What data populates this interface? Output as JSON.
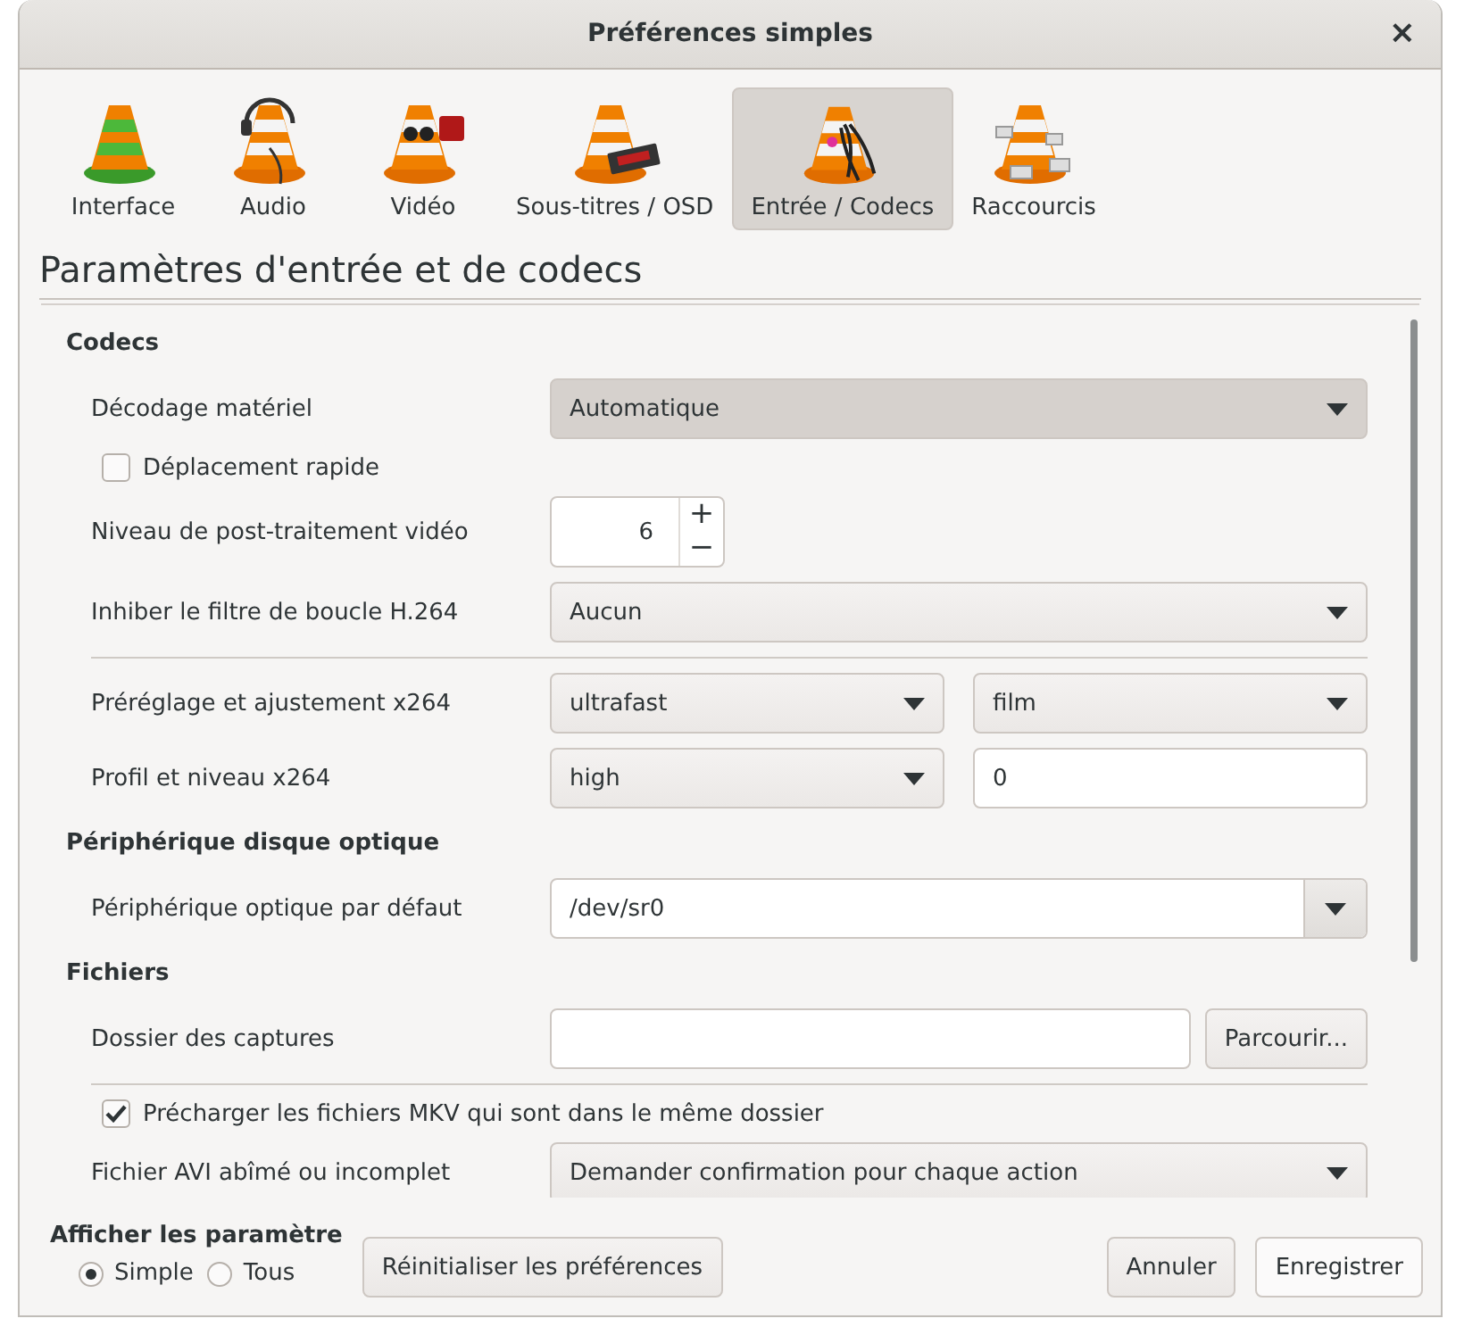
{
  "window": {
    "title": "Préférences simples",
    "close": "×"
  },
  "tabs": [
    {
      "label": "Interface",
      "kind": "interface",
      "selected": false
    },
    {
      "label": "Audio",
      "kind": "audio",
      "selected": false
    },
    {
      "label": "Vidéo",
      "kind": "video",
      "selected": false
    },
    {
      "label": "Sous-titres / OSD",
      "kind": "osd",
      "selected": false
    },
    {
      "label": "Entrée / Codecs",
      "kind": "codecs",
      "selected": true
    },
    {
      "label": "Raccourcis",
      "kind": "shortcuts",
      "selected": false
    }
  ],
  "heading": "Paramètres d'entrée et de codecs",
  "sections": [
    {
      "title": "Codecs",
      "rows": [
        {
          "kind": "select",
          "label": "Décodage matériel",
          "value": "Automatique",
          "hovered": true
        },
        {
          "kind": "checkbox",
          "label": "Déplacement rapide",
          "checked": false
        },
        {
          "kind": "spin",
          "label": "Niveau de post-traitement vidéo",
          "value": "6",
          "plus": "+",
          "minus": "−"
        },
        {
          "kind": "select",
          "label": "Inhiber le filtre de boucle H.264",
          "value": "Aucun",
          "hovered": false
        },
        {
          "kind": "separator"
        },
        {
          "kind": "select_pair",
          "label": "Préréglage et ajustement x264",
          "values": [
            "ultrafast",
            "film"
          ]
        },
        {
          "kind": "select_text",
          "label": "Profil et niveau x264",
          "value": "high",
          "text": "0"
        }
      ]
    },
    {
      "title": "Périphérique disque optique",
      "rows": [
        {
          "kind": "combo",
          "label": "Périphérique optique par défaut",
          "value": "/dev/sr0"
        }
      ]
    },
    {
      "title": "Fichiers",
      "rows": [
        {
          "kind": "folder",
          "label": "Dossier des captures",
          "button": "Parcourir..."
        },
        {
          "kind": "separator"
        },
        {
          "kind": "checkbox",
          "label": "Précharger les fichiers MKV qui sont dans le même dossier",
          "checked": true
        },
        {
          "kind": "select",
          "label": "Fichier AVI abîmé ou incomplet",
          "value": "Demander confirmation pour chaque action",
          "hovered": false
        }
      ]
    }
  ],
  "footer": {
    "title": "Afficher les paramètre",
    "modes": [
      {
        "label": "Simple",
        "selected": true
      },
      {
        "label": "Tous",
        "selected": false
      }
    ],
    "reset": "Réinitialiser les préférences",
    "cancel": "Annuler",
    "save": "Enregistrer"
  }
}
